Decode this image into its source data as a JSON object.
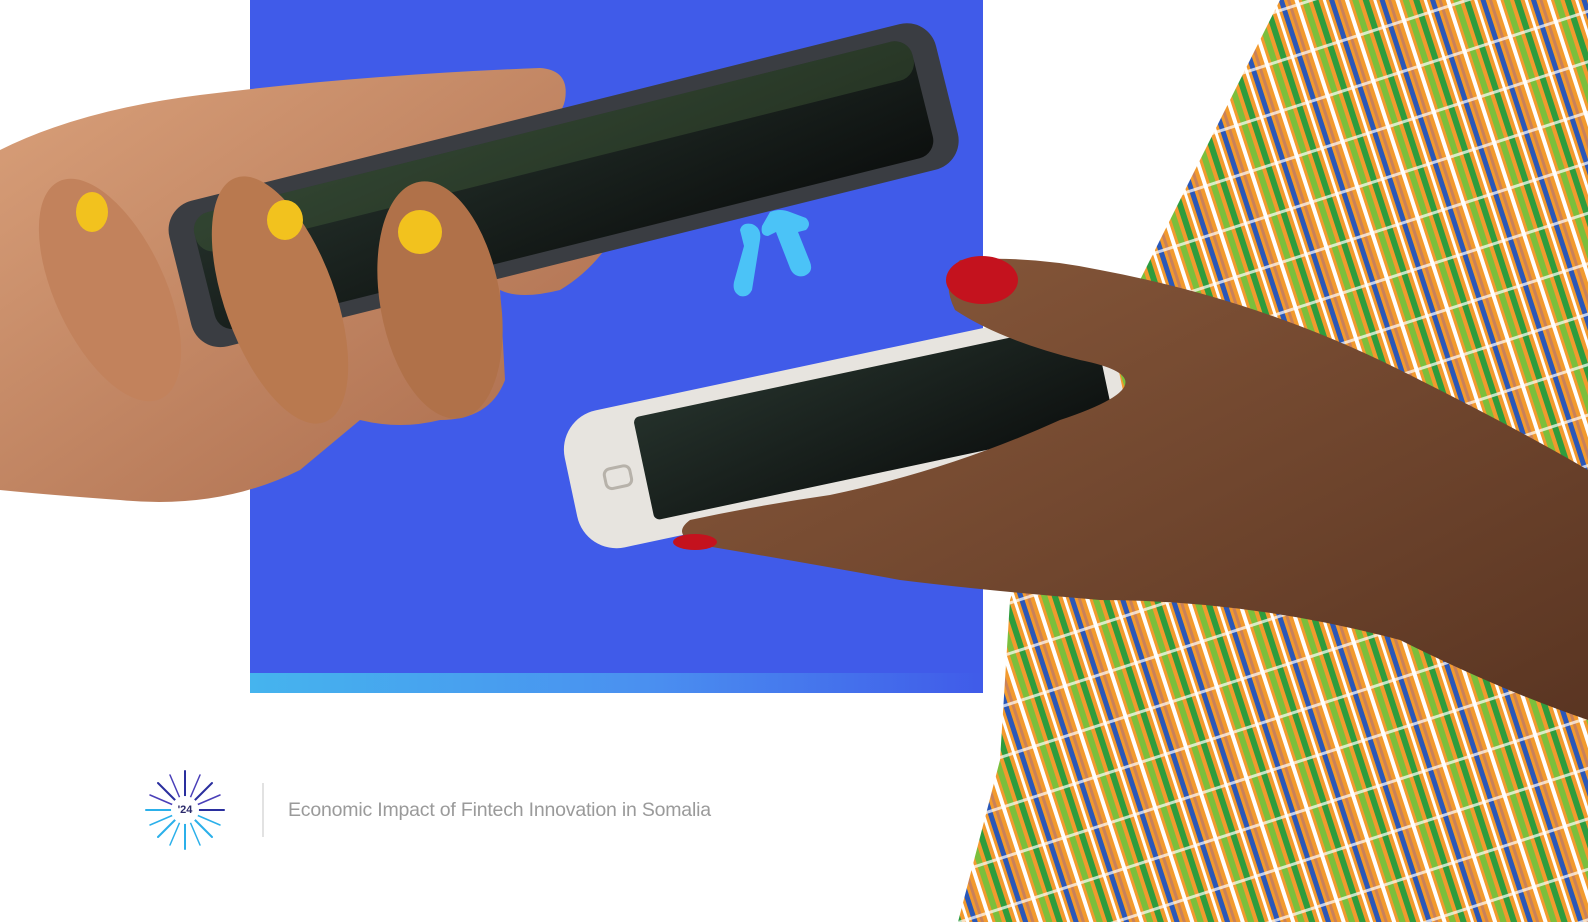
{
  "footer": {
    "logo_text": "'24",
    "title": "Economic Impact of Fintech Innovation in Somalia"
  },
  "icons": {
    "logo": "starburst-logo-icon",
    "center": "swap-arrows-icon"
  },
  "colors": {
    "panel_blue": "#405be9",
    "strip_light_blue": "#45b4ee",
    "accent_cyan": "#4bc3f7",
    "footer_text": "#9a9a9a",
    "logo_navy": "#2b2a6b"
  }
}
